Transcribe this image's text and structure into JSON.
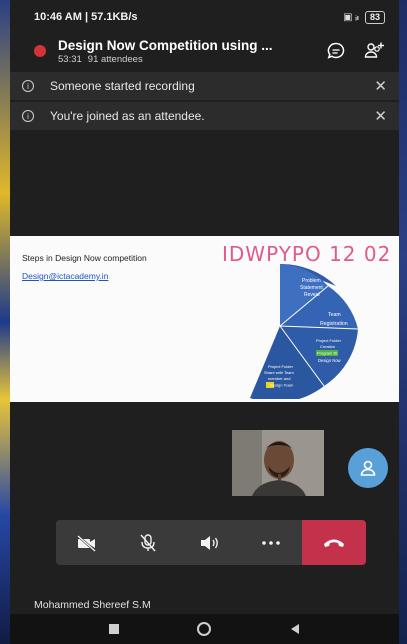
{
  "status_bar": {
    "time_speed": "10:46 AM | 57.1KB/s",
    "signal": "▣ ᵢₗ",
    "battery": "83"
  },
  "header": {
    "title": "Design Now Competition using ...",
    "duration": "53:31",
    "attendees": "91 attendees",
    "chat_icon": "chat-icon",
    "participants_icon": "add-participants-icon"
  },
  "banners": [
    {
      "message": "Someone started recording",
      "close": "✕"
    },
    {
      "message": "You're joined as an attendee.",
      "close": "✕"
    }
  ],
  "slide": {
    "title": "Steps in Design Now competition",
    "email": "Design@ictacademy.in",
    "handwriting": "IDWPYPO 12 02",
    "segments": [
      {
        "label": "Problem Statement Reveal"
      },
      {
        "label": "Team Registration"
      },
      {
        "label": "Project Folder Creation Program ID Design Now"
      },
      {
        "label": "Project Folder Share with Team member and Design Team"
      }
    ]
  },
  "controls": {
    "camera_icon": "camera-off-icon",
    "mic_icon": "mic-off-icon",
    "speaker_icon": "speaker-icon",
    "more_icon": "more-icon",
    "hangup_icon": "hang-up-icon"
  },
  "participant_name": "Mohammed Shereef S.M",
  "nav": {
    "recents": "recents-icon",
    "home": "home-icon",
    "back": "back-icon"
  },
  "colors": {
    "recording_dot": "#d13438",
    "hangup": "#c4314b",
    "avatar_button": "#5aa0d8",
    "handwriting": "#e05a8d",
    "link": "#1f54c2"
  }
}
